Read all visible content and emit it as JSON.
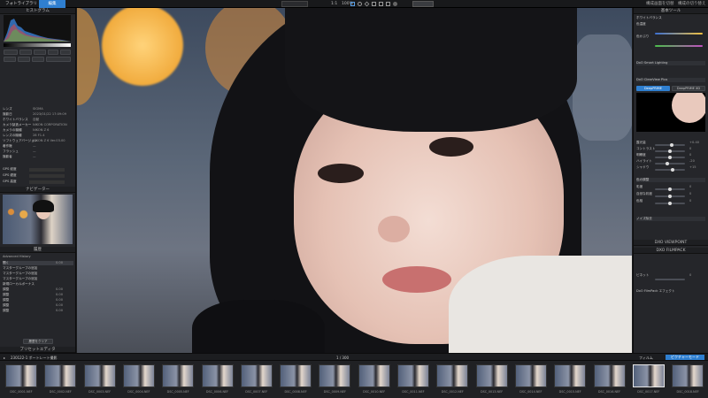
{
  "topbar": {
    "app_tab": "フォトライブラリ",
    "active_tab": "編集",
    "zoom": "100%",
    "ratio": "1:1",
    "right_menu_1": "構成画面を切替",
    "right_menu_2": "構成の切り替え"
  },
  "left_panel": {
    "histogram_title": "ヒストグラム",
    "info_rows": [
      {
        "label": "レンズ",
        "value": "SIGMA"
      },
      {
        "label": "撮影日",
        "value": "2023/01/22 17:09:09"
      },
      {
        "label": "ホワイトバランス",
        "value": "自動"
      },
      {
        "label": "カメラ製造メーカー",
        "value": "NIKON CORPORATION"
      },
      {
        "label": "カメラの機種",
        "value": "NIKON Z 6"
      },
      {
        "label": "レンズの機種",
        "value": "28 F1.4"
      },
      {
        "label": "ソフトウェアバージョン",
        "value": "NIKON Z 6 Ver.03.00"
      },
      {
        "label": "著作権",
        "value": "—"
      },
      {
        "label": "フラッシュ",
        "value": "—"
      },
      {
        "label": "撮影者",
        "value": "—"
      }
    ],
    "gps_rows": [
      "GPS 経度",
      "GPS 緯度",
      "GPS 高度"
    ],
    "navigator_title": "ナビゲーター",
    "history_title": "履歴",
    "history_header": "Advanced History",
    "history_items": [
      {
        "label": "開く",
        "value": "0.00"
      },
      {
        "label": "マスターグループの追加",
        "value": ""
      },
      {
        "label": "マスターグループの追加",
        "value": ""
      },
      {
        "label": "マスターグループの追加",
        "value": ""
      },
      {
        "label": "新規ローカルボーナス",
        "value": ""
      },
      {
        "label": "調整",
        "value": "0.00"
      },
      {
        "label": "調整",
        "value": "0.00"
      },
      {
        "label": "調整",
        "value": "0.00"
      },
      {
        "label": "調整",
        "value": "0.00"
      },
      {
        "label": "調整",
        "value": "0.00"
      }
    ],
    "history_button": "履歴をクリア",
    "footer": "プリセットエディタ"
  },
  "right_panel": {
    "title": "基本ツール",
    "section1": "ホワイトバランス",
    "wb_label": "色温度",
    "tint_label": "色かぶり",
    "section2": "DxO Smart Lighting",
    "section3": "DxO ClearView Plus",
    "mode_a": "DeepPRIME",
    "mode_b": "DeepPRIME XD",
    "sliders": [
      {
        "label": "露光量",
        "value": "+0.40",
        "pos": 0.55
      },
      {
        "label": "コントラスト",
        "value": "0",
        "pos": 0.5
      },
      {
        "label": "明瞭度",
        "value": "0",
        "pos": 0.5
      },
      {
        "label": "ハイライト",
        "value": "-20",
        "pos": 0.4
      },
      {
        "label": "シャドウ",
        "value": "+15",
        "pos": 0.6
      }
    ],
    "section4": "色の調整",
    "color_sliders": [
      {
        "label": "彩度",
        "value": "0",
        "pos": 0.5
      },
      {
        "label": "自然な彩度",
        "value": "0",
        "pos": 0.5
      },
      {
        "label": "色相",
        "value": "0",
        "pos": 0.5
      }
    ],
    "section5": "ノイズ除去",
    "viewpoint": "DXO VIEWPOINT",
    "filmpack": "DXO FILMPACK",
    "fp_row": "ビネット",
    "fp_value": "0",
    "fp_item": "DxO FilmPack エフェクト"
  },
  "filmstrip": {
    "path": "230122-1 ポートレート撮影",
    "count": "1 / 300",
    "right_a": "フィルム",
    "right_b": "ピクチャーモード",
    "thumbs": [
      "DSC_0001.NEF",
      "DSC_0002.NEF",
      "DSC_0003.NEF",
      "DSC_0004.NEF",
      "DSC_0005.NEF",
      "DSC_0006.NEF",
      "DSC_0007.NEF",
      "DSC_0008.NEF",
      "DSC_0009.NEF",
      "DSC_0010.NEF",
      "DSC_0011.NEF",
      "DSC_0012.NEF",
      "DSC_0013.NEF",
      "DSC_0014.NEF",
      "DSC_0015.NEF",
      "DSC_0016.NEF",
      "DSC_0017.NEF",
      "DSC_0018.NEF"
    ],
    "selected_index": 16
  },
  "colors": {
    "accent": "#2f7fd0",
    "panel": "#25262a",
    "background": "#1b1c1e"
  }
}
